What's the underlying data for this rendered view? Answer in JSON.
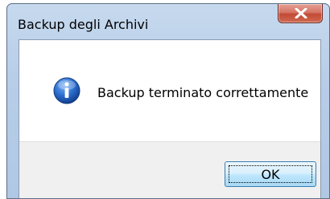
{
  "window": {
    "title": "Backup degli Archivi"
  },
  "message": {
    "text": "Backup terminato correttamente",
    "icon": "info-icon"
  },
  "buttons": {
    "ok_label": "OK",
    "close_icon": "close-icon"
  },
  "colors": {
    "close_button": "#c34a36",
    "info_icon": "#1f5fbf",
    "ok_button_border": "#3c7fb1",
    "footer_background": "#f0f0f0"
  }
}
